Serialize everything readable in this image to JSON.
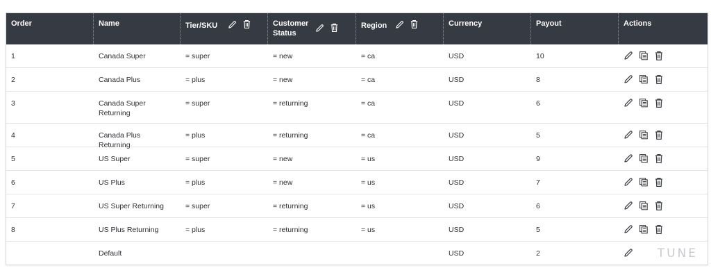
{
  "table": {
    "headers": {
      "order": "Order",
      "name": "Name",
      "tier": "Tier/SKU",
      "customer": "Customer Status",
      "region": "Region",
      "currency": "Currency",
      "payout": "Payout",
      "actions": "Actions"
    },
    "rows": [
      {
        "order": "1",
        "name": "Canada Super",
        "tier": "= super",
        "customer": "= new",
        "region": "= ca",
        "currency": "USD",
        "payout": "10"
      },
      {
        "order": "2",
        "name": "Canada Plus",
        "tier": "= plus",
        "customer": "= new",
        "region": "= ca",
        "currency": "USD",
        "payout": "8"
      },
      {
        "order": "3",
        "name": "Canada Super Returning",
        "tier": "= super",
        "customer": "= returning",
        "region": "= ca",
        "currency": "USD",
        "payout": "6"
      },
      {
        "order": "4",
        "name": "Canada Plus Returning",
        "tier": "= plus",
        "customer": "= returning",
        "region": "= ca",
        "currency": "USD",
        "payout": "5"
      },
      {
        "order": "5",
        "name": "US Super",
        "tier": "= super",
        "customer": "= new",
        "region": "= us",
        "currency": "USD",
        "payout": "9"
      },
      {
        "order": "6",
        "name": "US Plus",
        "tier": "= plus",
        "customer": "= new",
        "region": "= us",
        "currency": "USD",
        "payout": "7"
      },
      {
        "order": "7",
        "name": "US Super Returning",
        "tier": "= super",
        "customer": "= returning",
        "region": "= us",
        "currency": "USD",
        "payout": "6"
      },
      {
        "order": "8",
        "name": "US Plus Returning",
        "tier": "= plus",
        "customer": "= returning",
        "region": "= us",
        "currency": "USD",
        "payout": "5"
      },
      {
        "order": "",
        "name": "Default",
        "tier": "",
        "customer": "",
        "region": "",
        "currency": "USD",
        "payout": "2"
      }
    ]
  },
  "icons": {
    "edit": "pencil-icon",
    "copy": "copy-icon",
    "delete": "trash-icon"
  },
  "colors": {
    "header_bg": "#363a42",
    "header_text": "#ffffff",
    "row_text": "#2b2e33",
    "row_border": "#e3e5e8"
  },
  "watermark": "TUNE"
}
